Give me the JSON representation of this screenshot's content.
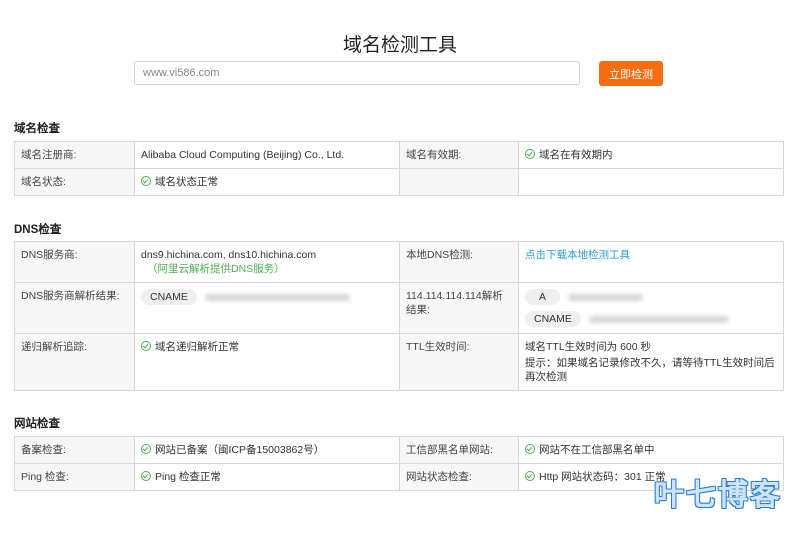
{
  "header": {
    "title": "域名检测工具",
    "search_placeholder": "www.vi586.com",
    "check_button": "立即检测"
  },
  "domain_section": {
    "title": "域名检查",
    "registrar_label": "域名注册商:",
    "registrar_value": "Alibaba Cloud Computing (Beijing) Co., Ltd.",
    "validity_label": "域名有效期:",
    "validity_value": "域名在有效期内",
    "status_label": "域名状态:",
    "status_value": "域名状态正常"
  },
  "dns_section": {
    "title": "DNS检查",
    "provider_label": "DNS服务商:",
    "provider_value": "dns9.hichina.com, dns10.hichina.com",
    "provider_note": "（阿里云解析提供DNS服务）",
    "local_dns_label": "本地DNS检测:",
    "local_dns_link": "点击下载本地检测工具",
    "resolve_label": "DNS服务商解析结果:",
    "resolve_type": "CNAME",
    "public_dns_label": "114.114.114.114解析结果:",
    "public_a_type": "A",
    "public_cname_type": "CNAME",
    "recursive_label": "递归解析追踪:",
    "recursive_value": "域名递归解析正常",
    "ttl_label": "TTL生效时间:",
    "ttl_value": "域名TTL生效时间为 600 秒",
    "ttl_tip": "提示：如果域名记录修改不久，请等待TTL生效时间后再次检测"
  },
  "site_section": {
    "title": "网站检查",
    "icp_label": "备案检查:",
    "icp_value": "网站已备案（闽ICP备15003862号）",
    "blacklist_label": "工信部黑名单网站:",
    "blacklist_value": "网站不在工信部黑名单中",
    "ping_label": "Ping 检查:",
    "ping_value": "Ping 检查正常",
    "http_label": "网站状态检查:",
    "http_value": "Http 网站状态码：301 正常"
  },
  "watermark": "叶七博客",
  "colors": {
    "accent": "#f76d10",
    "ok": "#4caf50",
    "link": "#2a9fd6"
  }
}
